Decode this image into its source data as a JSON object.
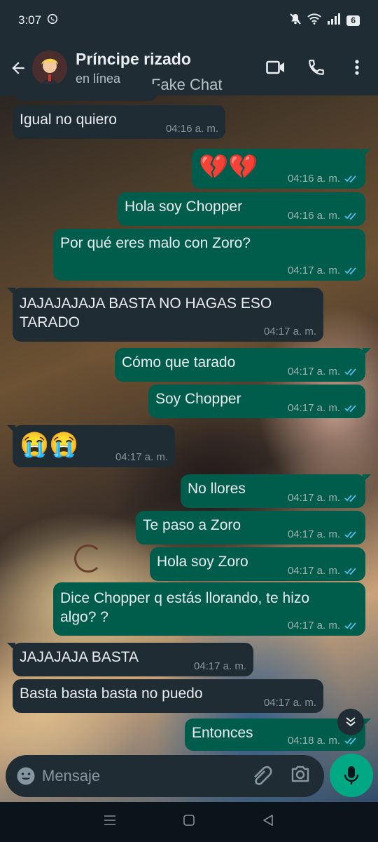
{
  "status_bar": {
    "time": "3:07",
    "battery": "6"
  },
  "header": {
    "contact_name": "Príncipe rizado",
    "contact_status": "en línea",
    "watermark": "Fake Chat"
  },
  "messages": [
    {
      "dir": "in",
      "text": "Igual no quiero",
      "time": "04:16 a. m."
    },
    {
      "dir": "out",
      "text": "💔💔",
      "time": "04:16 a. m."
    },
    {
      "dir": "out",
      "text": "Hola soy Chopper",
      "time": "04:16 a. m."
    },
    {
      "dir": "out",
      "text": "Por qué eres malo con Zoro?",
      "time": "04:17 a. m."
    },
    {
      "dir": "in",
      "text": "JAJAJAJAJA BASTA NO HAGAS ESO",
      "text2": "TARADO",
      "time": "04:17 a. m."
    },
    {
      "dir": "out",
      "text": "Cómo que tarado",
      "time": "04:17 a. m."
    },
    {
      "dir": "out",
      "text": "Soy Chopper",
      "time": "04:17 a. m."
    },
    {
      "dir": "in",
      "text": "😭😭",
      "time": "04:17 a. m."
    },
    {
      "dir": "out",
      "text": "No llores",
      "time": "04:17 a. m."
    },
    {
      "dir": "out",
      "text": "Te paso a Zoro",
      "time": "04:17 a. m."
    },
    {
      "dir": "out",
      "text": "Hola soy Zoro",
      "time": "04:17 a. m."
    },
    {
      "dir": "out",
      "text": "Dice Chopper q estás llorando,  te hizo",
      "text2": "algo? ?",
      "time": "04:17 a. m."
    },
    {
      "dir": "in",
      "text": "JAJAJAJA BASTA",
      "time": "04:17 a. m."
    },
    {
      "dir": "in",
      "text": "Basta basta basta no puedo",
      "time": "04:17 a. m."
    },
    {
      "dir": "out",
      "text": "Entonces",
      "time": "04:18 a. m."
    }
  ],
  "composer": {
    "placeholder": "Mensaje"
  },
  "icons": {
    "back": "arrow-left-icon",
    "video": "video-call-icon",
    "call": "phone-icon",
    "menu": "more-vert-icon",
    "emoji": "emoji-icon",
    "attach": "paperclip-icon",
    "camera": "camera-icon",
    "mic": "mic-icon",
    "scroll": "double-chevron-down-icon"
  },
  "colors": {
    "incoming": "#1f2c34",
    "outgoing": "#005c4b",
    "accent": "#00a884",
    "read_ticks": "#53bdeb"
  }
}
